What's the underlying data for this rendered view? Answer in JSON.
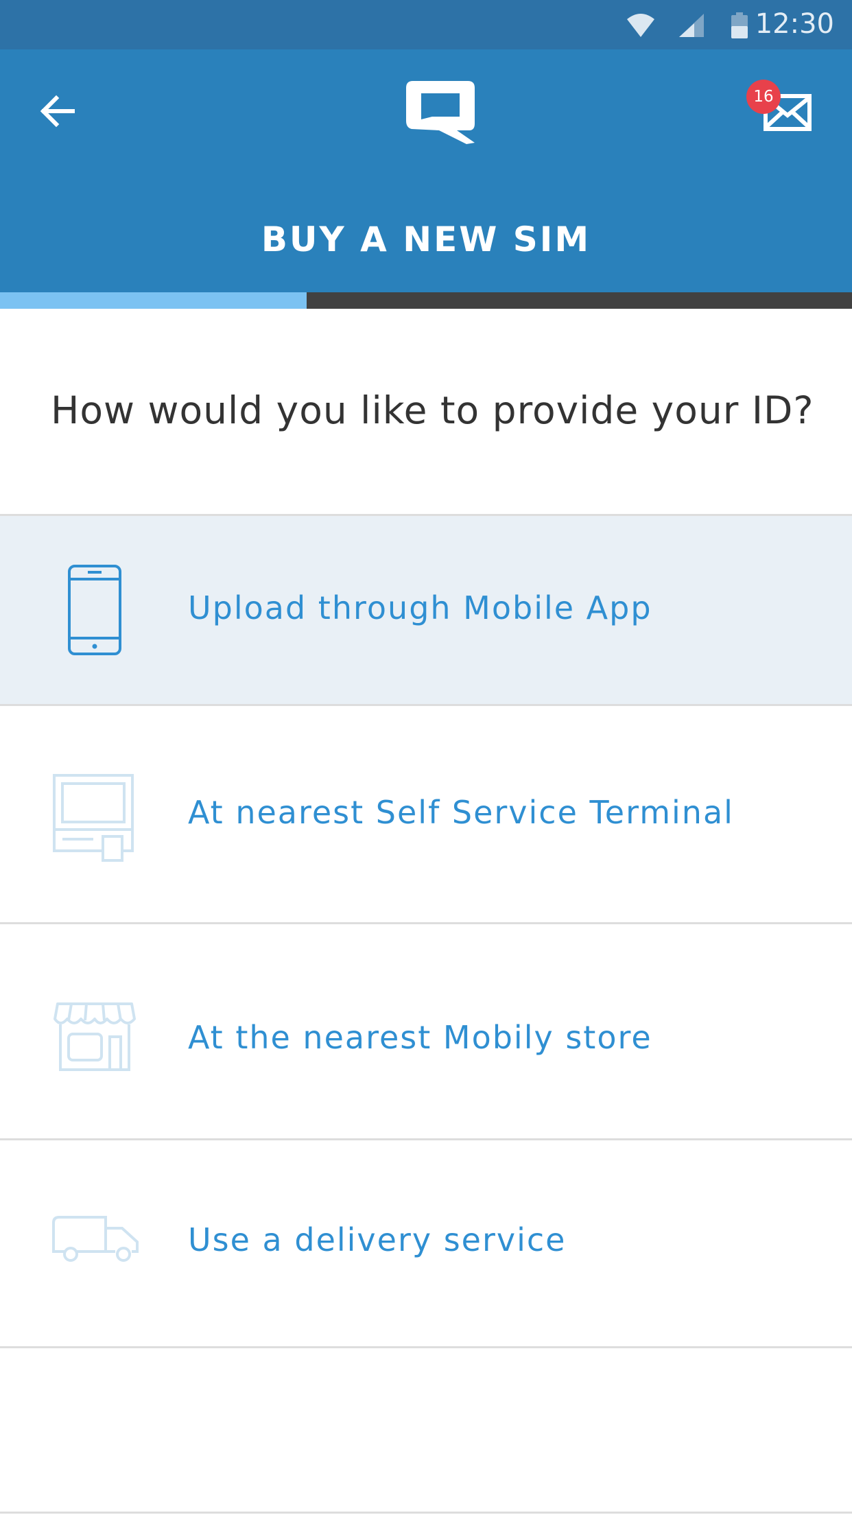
{
  "status_bar": {
    "time": "12:30",
    "icons": [
      "wifi-icon",
      "cell-signal-icon",
      "battery-icon"
    ]
  },
  "header": {
    "back_icon": "arrow-left-icon",
    "logo": "mobily-logo",
    "mail_icon": "envelope-icon",
    "mail_count": "16",
    "title": "BUY A NEW SIM"
  },
  "progress": {
    "fraction": 0.36
  },
  "question": "How would you like to provide your ID?",
  "options": [
    {
      "label": "Upload through Mobile App",
      "icon": "smartphone-icon",
      "selected": true
    },
    {
      "label": "At nearest Self Service Terminal",
      "icon": "kiosk-terminal-icon",
      "selected": false
    },
    {
      "label": "At the nearest Mobily store",
      "icon": "storefront-icon",
      "selected": false
    },
    {
      "label": "Use a delivery service",
      "icon": "delivery-truck-icon",
      "selected": false
    }
  ],
  "colors": {
    "status_bar": "#2d72a7",
    "header": "#2a81bb",
    "progress_fill": "#7bc2f2",
    "progress_track": "#414141",
    "option_text": "#2f8fd2",
    "selected_row": "#e9f0f6",
    "badge": "#e8414b"
  }
}
